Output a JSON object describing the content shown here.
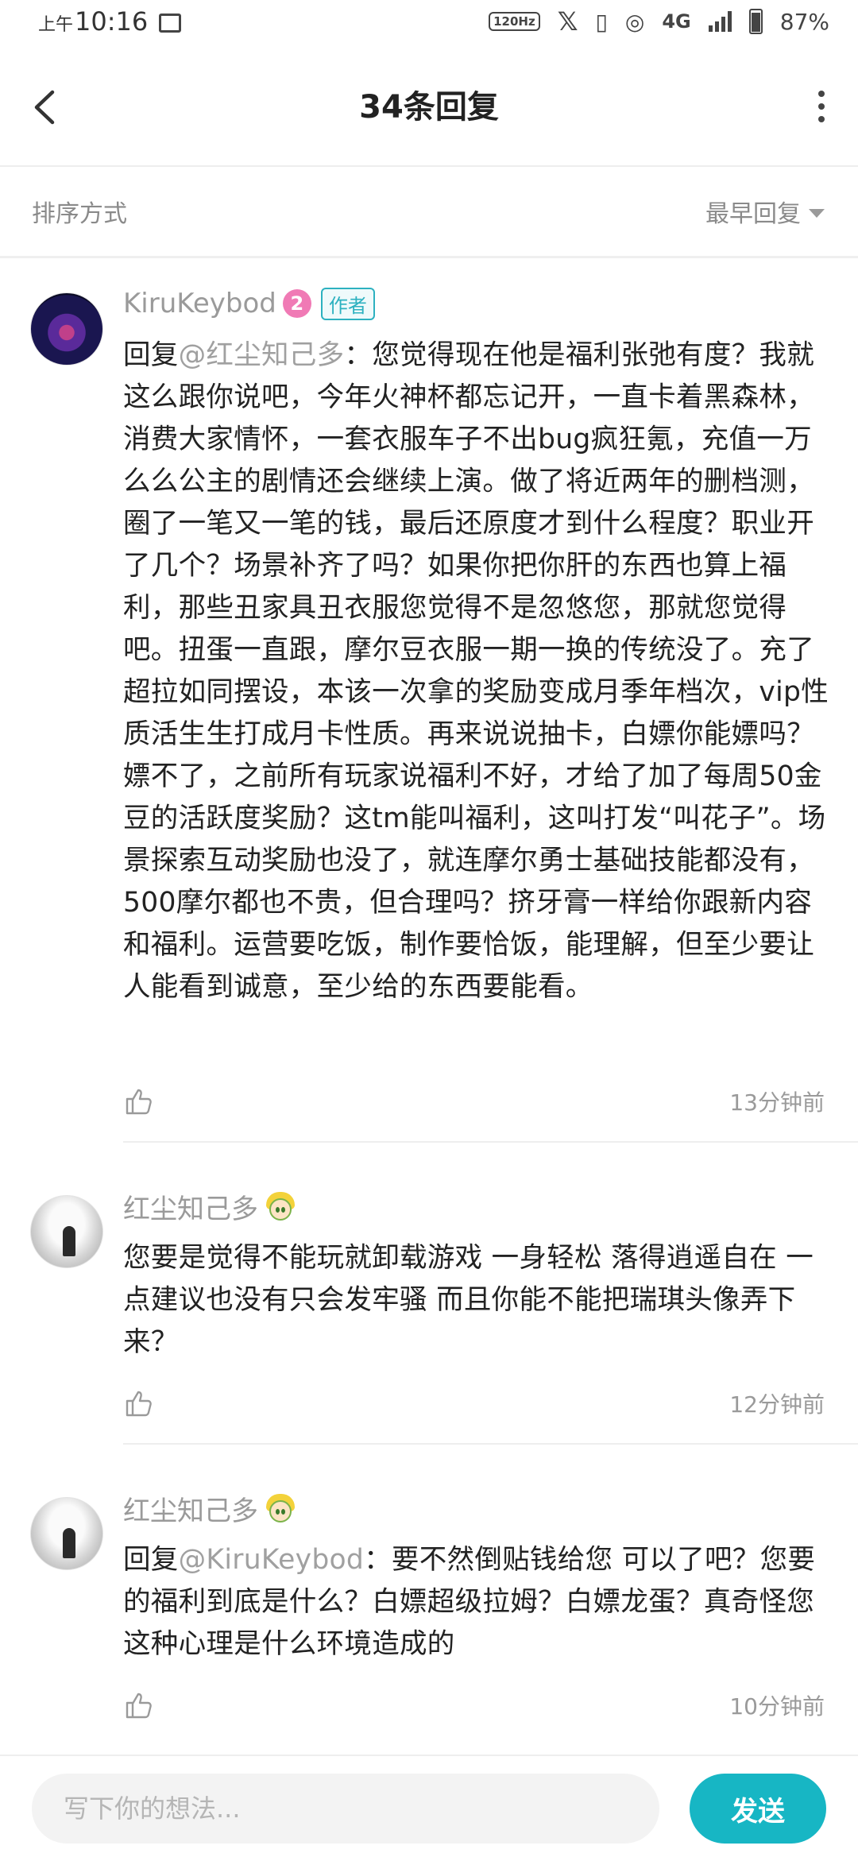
{
  "status_bar": {
    "ampm": "上午",
    "time": "10:16",
    "hz": "120Hz",
    "network": "4G",
    "battery": "87%",
    "icons": [
      "image-icon",
      "x-logo-icon",
      "vibrate-icon",
      "hotspot-icon",
      "signal-icon",
      "battery-icon"
    ]
  },
  "header": {
    "title": "34条回复"
  },
  "sort": {
    "label": "排序方式",
    "value": "最早回复"
  },
  "comments": [
    {
      "name": "KiruKeybod",
      "level": "2",
      "author_tag": "作者",
      "reply_prefix": "回复",
      "mention": "@红尘知己多",
      "text": "：您觉得现在他是福利张弛有度？我就这么跟你说吧，今年火神杯都忘记开，一直卡着黑森林，消费大家情怀，一套衣服车子不出bug疯狂氪，充值一万么么公主的剧情还会继续上演。做了将近两年的删档测，圈了一笔又一笔的钱，最后还原度才到什么程度？职业开了几个？场景补齐了吗？如果你把你肝的东西也算上福利，那些丑家具丑衣服您觉得不是忽悠您，那就您觉得吧。扭蛋一直跟，摩尔豆衣服一期一换的传统没了。充了超拉如同摆设，本该一次拿的奖励变成月季年档次，vip性质活生生打成月卡性质。再来说说抽卡，白嫖你能嫖吗？嫖不了，之前所有玩家说福利不好，才给了加了每周50金豆的活跃度奖励？这tm能叫福利，这叫打发“叫花子”。场景探索互动奖励也没了，就连摩尔勇士基础技能都没有，500摩尔都也不贵，但合理吗？挤牙膏一样给你跟新内容和福利。运营要吃饭，制作要恰饭，能理解，但至少要让人能看到诚意，至少给的东西要能看。",
      "time": "13分钟前"
    },
    {
      "name": "红尘知己多",
      "text": "您要是觉得不能玩就卸载游戏 一身轻松 落得逍遥自在 一点建议也没有只会发牢骚 而且你能不能把瑞琪头像弄下来？",
      "time": "12分钟前"
    },
    {
      "name": "红尘知己多",
      "reply_prefix": "回复",
      "mention": "@KiruKeybod",
      "text": "：要不然倒贴钱给您 可以了吧？您要的福利到底是什么？白嫖超级拉姆？白嫖龙蛋？真奇怪您这种心理是什么环境造成的",
      "time": "10分钟前"
    }
  ],
  "composer": {
    "placeholder": "写下你的想法...",
    "send_label": "发送"
  },
  "colors": {
    "accent": "#17b6c4",
    "muted": "#9a9a9a"
  }
}
